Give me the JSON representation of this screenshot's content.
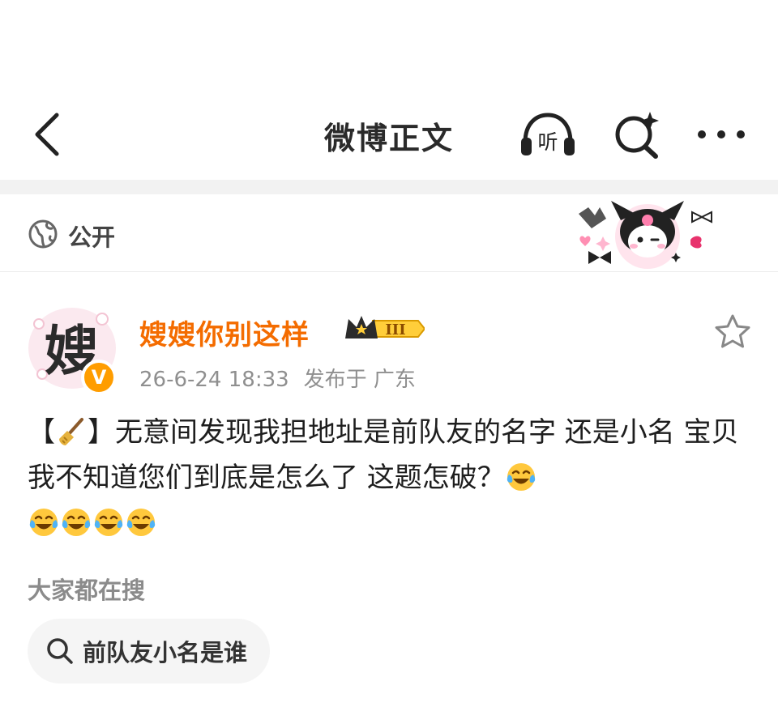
{
  "nav": {
    "title": "微博正文",
    "listen_label": "听"
  },
  "visibility": {
    "label": "公开"
  },
  "post": {
    "avatar_char": "嫂",
    "verified_mark": "V",
    "username": "嫂嫂你别这样",
    "badge_level": "III",
    "timestamp": "26-6-24 18:33",
    "location": "发布于 广东",
    "text_open": "【",
    "text_close": "】无意间发现我担地址是前队友的名字 还是小名 宝贝我不知道您们到底是怎么了 这题怎破？",
    "trailing_emoji_count": 5
  },
  "hot_search": {
    "label": "大家都在搜",
    "chip": "前队友小名是谁"
  },
  "colors": {
    "username": "#f46c00",
    "verified": "#ff9d00",
    "emoji": "#ffc83d"
  },
  "icons": [
    "back-arrow-icon",
    "headphones-icon",
    "search-sparkle-icon",
    "more-dots-icon",
    "globe-icon",
    "star-icon",
    "broom-icon",
    "laugh-cry-emoji",
    "search-icon"
  ]
}
